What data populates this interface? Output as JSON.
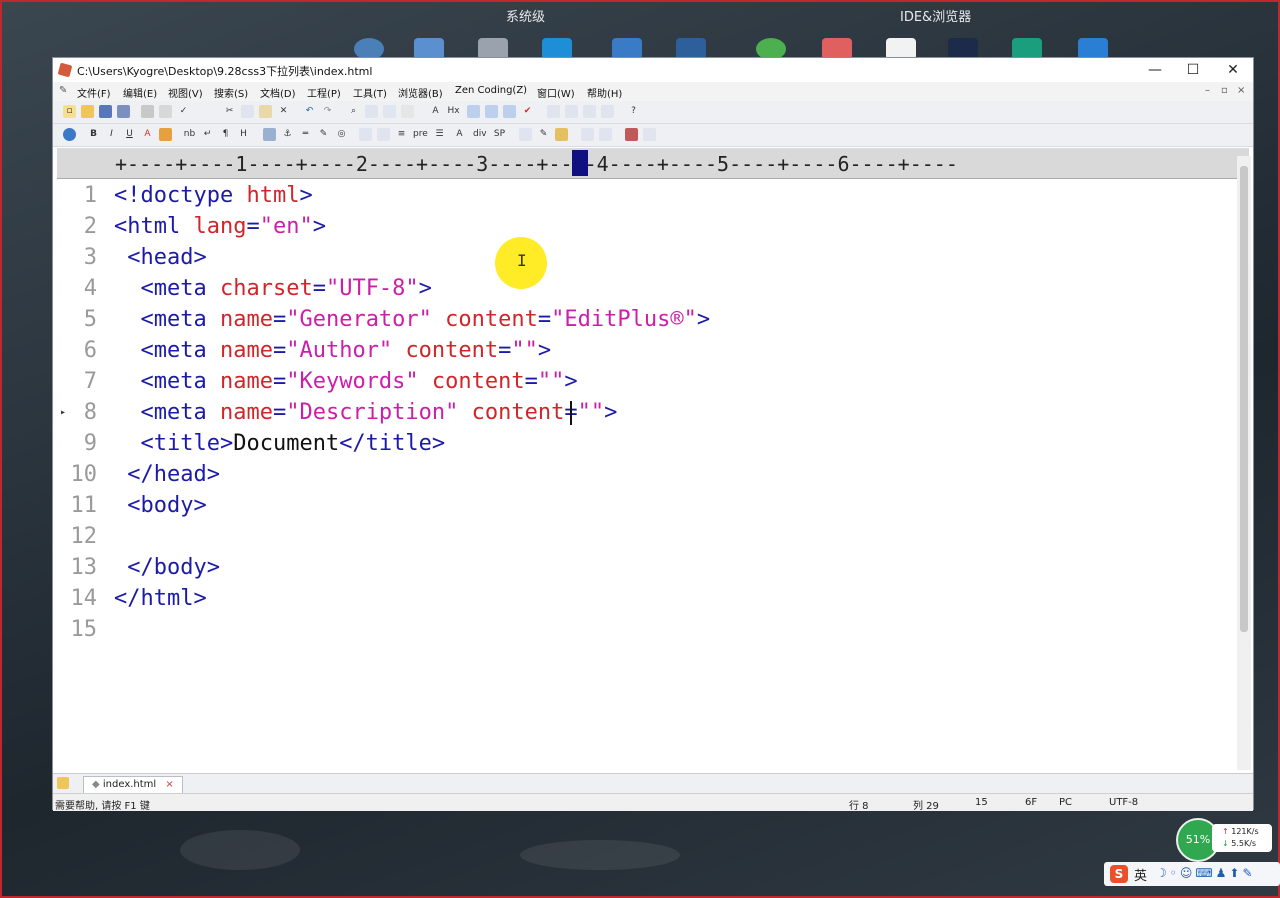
{
  "desktop": {
    "group_labels": [
      "系统级",
      "IDE&浏览器"
    ]
  },
  "window": {
    "title": "C:\\Users\\Kyogre\\Desktop\\9.28css3下拉列表\\index.html",
    "minimize": "—",
    "maximize": "☐",
    "close": "✕"
  },
  "menu": {
    "items": [
      "文件(F)",
      "编辑(E)",
      "视图(V)",
      "搜索(S)",
      "文档(D)",
      "工程(P)",
      "工具(T)",
      "浏览器(B)",
      "Zen Coding(Z)",
      "窗口(W)",
      "帮助(H)"
    ],
    "mdi_controls": [
      "–",
      "▫",
      "×"
    ]
  },
  "ruler": {
    "text": "+----+----1----+----2----+----3----+----4----+----5----+----6----+----"
  },
  "editor": {
    "lines": [
      {
        "n": "1",
        "parts": [
          [
            "t",
            "<!doctype "
          ],
          [
            "a",
            "html"
          ],
          [
            "t",
            ">"
          ]
        ]
      },
      {
        "n": "2",
        "parts": [
          [
            "t",
            "<html "
          ],
          [
            "a",
            "lang"
          ],
          [
            "t",
            "="
          ],
          [
            "s",
            "\"en\""
          ],
          [
            "t",
            ">"
          ]
        ]
      },
      {
        "n": "3",
        "parts": [
          [
            "x",
            " "
          ],
          [
            "t",
            "<head>"
          ]
        ]
      },
      {
        "n": "4",
        "parts": [
          [
            "x",
            "  "
          ],
          [
            "t",
            "<meta "
          ],
          [
            "a",
            "charset"
          ],
          [
            "t",
            "="
          ],
          [
            "s",
            "\"UTF-8\""
          ],
          [
            "t",
            ">"
          ]
        ]
      },
      {
        "n": "5",
        "parts": [
          [
            "x",
            "  "
          ],
          [
            "t",
            "<meta "
          ],
          [
            "a",
            "name"
          ],
          [
            "t",
            "="
          ],
          [
            "s",
            "\"Generator\""
          ],
          [
            "x",
            " "
          ],
          [
            "a",
            "content"
          ],
          [
            "t",
            "="
          ],
          [
            "s",
            "\"EditPlus®\""
          ],
          [
            "t",
            ">"
          ]
        ]
      },
      {
        "n": "6",
        "parts": [
          [
            "x",
            "  "
          ],
          [
            "t",
            "<meta "
          ],
          [
            "a",
            "name"
          ],
          [
            "t",
            "="
          ],
          [
            "s",
            "\"Author\""
          ],
          [
            "x",
            " "
          ],
          [
            "a",
            "content"
          ],
          [
            "t",
            "="
          ],
          [
            "s",
            "\"\""
          ],
          [
            "t",
            ">"
          ]
        ]
      },
      {
        "n": "7",
        "parts": [
          [
            "x",
            "  "
          ],
          [
            "t",
            "<meta "
          ],
          [
            "a",
            "name"
          ],
          [
            "t",
            "="
          ],
          [
            "s",
            "\"Keywords\""
          ],
          [
            "x",
            " "
          ],
          [
            "a",
            "content"
          ],
          [
            "t",
            "="
          ],
          [
            "s",
            "\"\""
          ],
          [
            "t",
            ">"
          ]
        ]
      },
      {
        "n": "8",
        "parts": [
          [
            "x",
            "  "
          ],
          [
            "t",
            "<meta "
          ],
          [
            "a",
            "name"
          ],
          [
            "t",
            "="
          ],
          [
            "s",
            "\"Description\""
          ],
          [
            "x",
            " "
          ],
          [
            "a",
            "content"
          ],
          [
            "t",
            "="
          ],
          [
            "s",
            "\"\""
          ],
          [
            "t",
            ">"
          ]
        ]
      },
      {
        "n": "9",
        "parts": [
          [
            "x",
            "  "
          ],
          [
            "t",
            "<title>"
          ],
          [
            "x",
            "Document"
          ],
          [
            "t",
            "</title>"
          ]
        ]
      },
      {
        "n": "10",
        "parts": [
          [
            "x",
            " "
          ],
          [
            "t",
            "</head>"
          ]
        ]
      },
      {
        "n": "11",
        "parts": [
          [
            "x",
            " "
          ],
          [
            "t",
            "<body>"
          ]
        ]
      },
      {
        "n": "12",
        "parts": []
      },
      {
        "n": "13",
        "parts": [
          [
            "x",
            " "
          ],
          [
            "t",
            "</body>"
          ]
        ]
      },
      {
        "n": "14",
        "parts": [
          [
            "t",
            "</html>"
          ]
        ]
      },
      {
        "n": "15",
        "parts": []
      }
    ],
    "current_line": "8"
  },
  "tabs": [
    {
      "label": "index.html"
    }
  ],
  "status": {
    "help": "需要帮助, 请按 F1 键",
    "row": "行 8",
    "col": "列 29",
    "num": "15",
    "hex": "6F",
    "eol": "PC",
    "encoding": "UTF-8"
  },
  "network": {
    "percent": "51%",
    "up": "121K/s",
    "down": "5.5K/s"
  },
  "tray": {
    "s": "S",
    "lang": "英"
  }
}
